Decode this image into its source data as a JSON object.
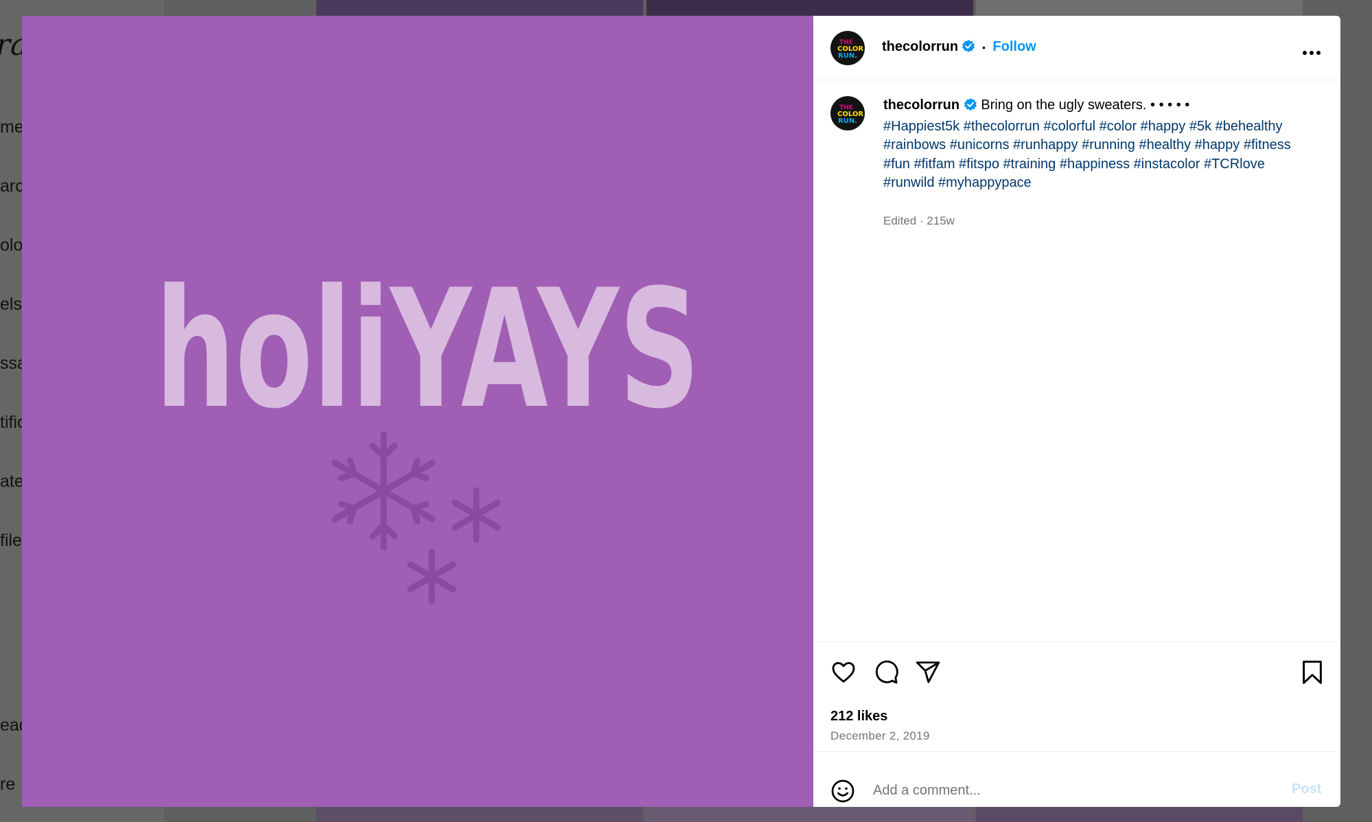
{
  "background": {
    "logo_fragment": "ra",
    "nav_fragments": [
      "me",
      "arch",
      "olor",
      "els",
      "ssa",
      "tific",
      "ate",
      "file",
      "ead",
      "re"
    ]
  },
  "post_image": {
    "headline": "holiYAYS",
    "background_color": "#a05eb5",
    "headline_color": "#d8bade",
    "snowflake_color": "#8a4aa0",
    "decoration_icons": [
      "snowflake-icon",
      "asterisk-icon",
      "asterisk-icon"
    ]
  },
  "header": {
    "username": "thecolorrun",
    "verified": true,
    "separator": "•",
    "follow_label": "Follow",
    "more_icon": "more-options-icon"
  },
  "caption": {
    "username": "thecolorrun",
    "text": "Bring on the ugly sweaters. • • • • •",
    "hashtags": "#Happiest5k #thecolorrun #colorful #color #happy #5k #behealthy #rainbows #unicorns #runhappy #running #healthy #happy #fitness #fun #fitfam #fitspo #training #happiness #instacolor #TCRlove #runwild #myhappypace",
    "meta": "Edited · 215w"
  },
  "actions": {
    "icons": [
      "heart-icon",
      "comment-icon",
      "share-icon",
      "bookmark-icon"
    ],
    "likes": "212 likes",
    "date": "December 2, 2019"
  },
  "comment_box": {
    "emoji_icon": "emoji-icon",
    "placeholder": "Add a comment...",
    "post_label": "Post"
  },
  "colors": {
    "accent": "#0095f6",
    "hashtag": "#00376b",
    "verified": "#0095f6"
  }
}
